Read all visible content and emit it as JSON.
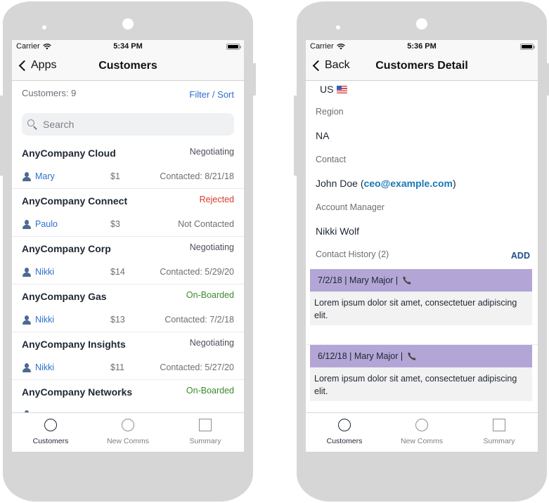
{
  "left_phone": {
    "status_bar": {
      "carrier": "Carrier",
      "time": "5:34 PM"
    },
    "nav": {
      "back_label": "Apps",
      "title": "Customers"
    },
    "list_header": {
      "count_label": "Customers: 9",
      "filter_sort_label": "Filter / Sort"
    },
    "search": {
      "placeholder": "Search",
      "value": ""
    },
    "customers": [
      {
        "name": "AnyCompany Cloud",
        "stage": "Negotiating",
        "stage_color": "#4a4f57",
        "owner": "Mary",
        "amount": "$1",
        "contact": "Contacted: 8/21/18"
      },
      {
        "name": "AnyCompany Connect",
        "stage": "Rejected",
        "stage_color": "#d93a2b",
        "owner": "Paulo",
        "amount": "$3",
        "contact": "Not Contacted"
      },
      {
        "name": "AnyCompany Corp",
        "stage": "Negotiating",
        "stage_color": "#4a4f57",
        "owner": "Nikki",
        "amount": "$14",
        "contact": "Contacted: 5/29/20"
      },
      {
        "name": "AnyCompany Gas",
        "stage": "On-Boarded",
        "stage_color": "#3d8a2e",
        "owner": "Nikki",
        "amount": "$13",
        "contact": "Contacted: 7/2/18"
      },
      {
        "name": "AnyCompany Insights",
        "stage": "Negotiating",
        "stage_color": "#4a4f57",
        "owner": "Nikki",
        "amount": "$11",
        "contact": "Contacted: 5/27/20"
      },
      {
        "name": "AnyCompany Networks",
        "stage": "On-Boarded",
        "stage_color": "#3d8a2e",
        "owner": "",
        "amount": "",
        "contact": ""
      }
    ],
    "tabs": [
      {
        "label": "Customers",
        "icon": "circle-icon",
        "active": true
      },
      {
        "label": "New Comms",
        "icon": "circle-icon",
        "active": false
      },
      {
        "label": "Summary",
        "icon": "square-icon",
        "active": false
      }
    ]
  },
  "right_phone": {
    "status_bar": {
      "carrier": "Carrier",
      "time": "5:36 PM"
    },
    "nav": {
      "back_label": "Back",
      "title": "Customers Detail"
    },
    "detail": {
      "country": "US",
      "country_flag_icon": "us-flag-icon",
      "region_label": "Region",
      "region_value": "NA",
      "contact_label": "Contact",
      "contact_name_prefix": "John Doe (",
      "contact_email": "ceo@example.com",
      "contact_name_suffix": ")",
      "account_manager_label": "Account Manager",
      "account_manager_value": "Nikki Wolf",
      "history_label": "Contact History (2)",
      "add_label": "ADD",
      "history": [
        {
          "header": "7/2/18 | Mary Major |",
          "icon": "phone-icon",
          "body": "Lorem ipsum dolor sit amet, consectetuer adipiscing elit."
        },
        {
          "header": "6/12/18 | Mary Major |",
          "icon": "phone-icon",
          "body": "Lorem ipsum dolor sit amet, consectetuer adipiscing elit."
        }
      ]
    },
    "tabs": [
      {
        "label": "Customers",
        "icon": "circle-icon",
        "active": true
      },
      {
        "label": "New Comms",
        "icon": "circle-icon",
        "active": false
      },
      {
        "label": "Summary",
        "icon": "square-icon",
        "active": false
      }
    ]
  },
  "colors": {
    "link_blue": "#2f6fd0",
    "email_blue": "#1a78b5",
    "add_blue": "#1e4f8a",
    "history_header": "#b3a6d6",
    "device_frame": "#d6d6d6"
  }
}
